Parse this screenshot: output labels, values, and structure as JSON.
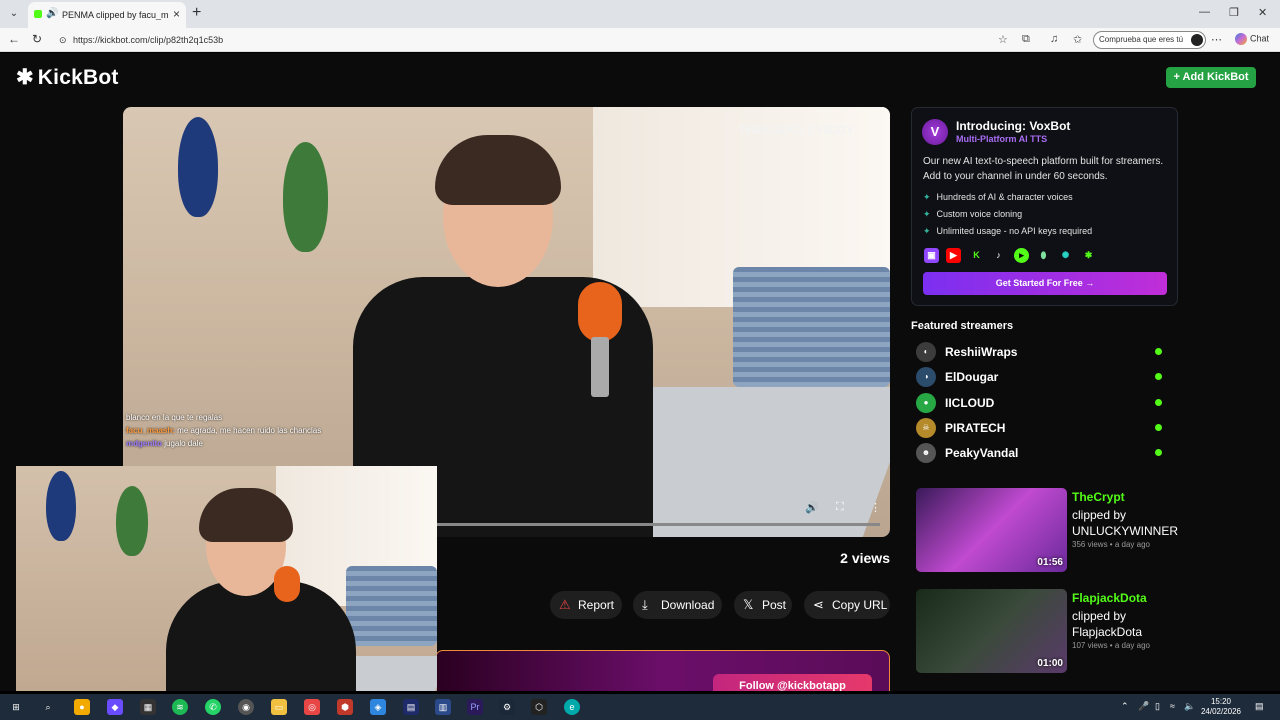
{
  "browser": {
    "tab_title": "PENMA clipped by facu_maash",
    "new_tab": "+",
    "url": "https://kickbot.com/clip/p82th2q1c53b",
    "verify_label": "Comprueba que eres tú",
    "chat_label": "Chat"
  },
  "site": {
    "logo": "KickBot",
    "add_button": "+ Add KickBot"
  },
  "player": {
    "watermark": "THIIAGOOLEVICOY",
    "chat": [
      {
        "user": "",
        "text": "blanco en la que te regalas"
      },
      {
        "user": "facu_maash:",
        "text": "me agrada, me hacen ruido las chanclas"
      },
      {
        "user": "mdgenito",
        "text": "jugalo dale"
      }
    ]
  },
  "clip": {
    "views": "2 views",
    "actions": {
      "report": "Report",
      "download": "Download",
      "post": "Post",
      "copy": "Copy URL"
    },
    "follow_label": "Follow @kickbotapp"
  },
  "voxbot": {
    "title": "Introducing: VoxBot",
    "subtitle": "Multi-Platform AI TTS",
    "description": "Our new AI text-to-speech platform built for streamers. Add to your channel in under 60 seconds.",
    "features": [
      "Hundreds of AI & character voices",
      "Custom voice cloning",
      "Unlimited usage - no API keys required"
    ],
    "cta": "Get Started For Free →"
  },
  "featured": {
    "title": "Featured streamers",
    "streamers": [
      {
        "name": "ReshiiWraps"
      },
      {
        "name": "ElDougar"
      },
      {
        "name": "IICLOUD"
      },
      {
        "name": "PIRATECH"
      },
      {
        "name": "PeakyVandal"
      }
    ]
  },
  "clips": [
    {
      "channel": "TheCrypt",
      "by": "clipped by UNLUCKYWINNER",
      "meta": "356 views • a day ago",
      "duration": "01:56"
    },
    {
      "channel": "FlapjackDota",
      "by": "clipped by FlapjackDota",
      "meta": "107 views • a day ago",
      "duration": "01:00"
    }
  ],
  "taskbar": {
    "time": "15:20",
    "date": "24/02/2026"
  },
  "colors": {
    "accent_green": "#53fc18",
    "button_green": "#25a244",
    "vox_purple": "#7b2ff0"
  }
}
